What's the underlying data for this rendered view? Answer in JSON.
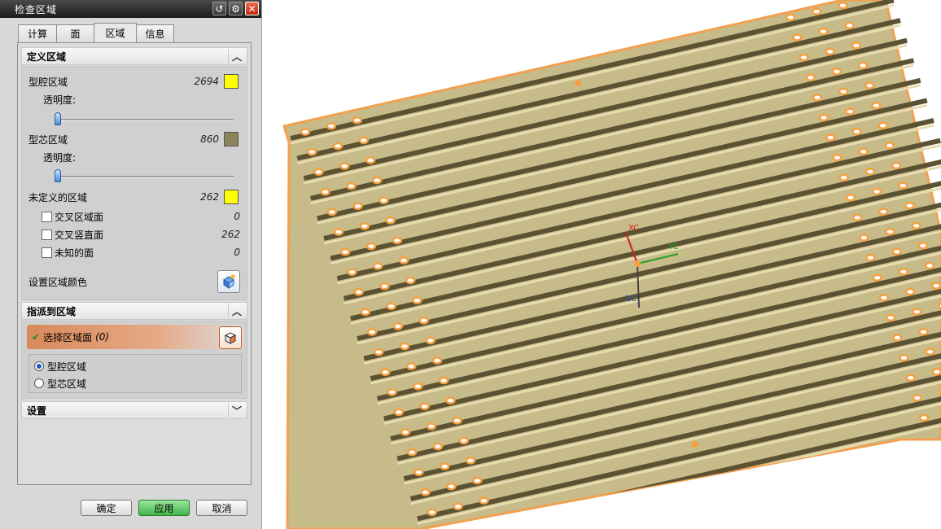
{
  "dialog": {
    "title": "检查区域",
    "tabs": [
      "计算",
      "面",
      "区域",
      "信息"
    ],
    "active_tab": "区域",
    "define_section": {
      "header": "定义区域",
      "cavity": {
        "label": "型腔区域",
        "count": "2694",
        "color": "#ffff00"
      },
      "transparency_label_1": "透明度:",
      "core": {
        "label": "型芯区域",
        "count": "860",
        "color": "#8c835a"
      },
      "transparency_label_2": "透明度:",
      "undefined": {
        "label": "未定义的区域",
        "count": "262",
        "color": "#ffff00"
      },
      "cross_region_faces": {
        "label": "交叉区域面",
        "count": "0"
      },
      "cross_vertical_faces": {
        "label": "交叉竖直面",
        "count": "262"
      },
      "unknown_faces": {
        "label": "未知的面",
        "count": "0"
      },
      "set_color_label": "设置区域颜色"
    },
    "assign_section": {
      "header": "指派到区域",
      "select_faces": "选择区域面",
      "select_count": "(0)",
      "radio_cavity": "型腔区域",
      "radio_core": "型芯区域"
    },
    "settings_section": {
      "header": "设置"
    },
    "buttons": {
      "ok": "确定",
      "apply": "应用",
      "cancel": "取消"
    }
  },
  "viewport": {
    "triad": {
      "x": "XC",
      "y": "YC",
      "z": "ZC"
    },
    "colors": {
      "body": "#c8bb8a",
      "groove": "#5a5232",
      "highlight": "#f5a040",
      "edge": "#f0a050"
    }
  }
}
